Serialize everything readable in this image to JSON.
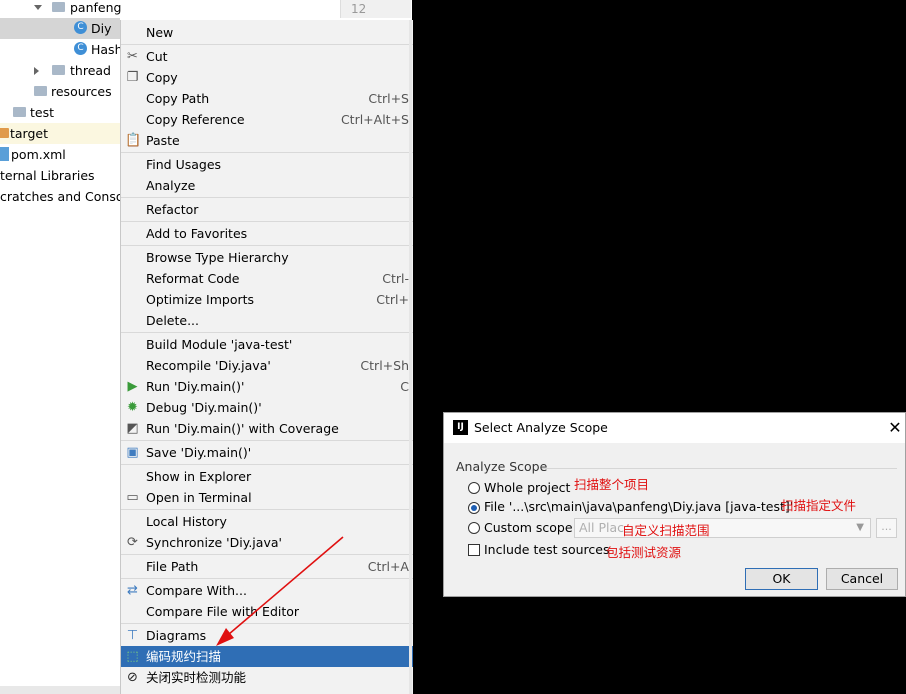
{
  "project_tree": {
    "gutter_line_number": "12",
    "items": [
      {
        "label": "panfeng",
        "kind": "folder",
        "state": "expanded"
      },
      {
        "label": "Diy",
        "kind": "class",
        "state": "selected"
      },
      {
        "label": "Hash",
        "kind": "class"
      },
      {
        "label": "thread",
        "kind": "folder",
        "state": "collapsed"
      },
      {
        "label": "resources",
        "kind": "folder"
      },
      {
        "label": "test",
        "kind": "folder"
      },
      {
        "label": "target",
        "kind": "folder-excluded",
        "state": "highlighted"
      },
      {
        "label": "pom.xml",
        "kind": "xml"
      },
      {
        "label": "ternal Libraries",
        "kind": "library"
      },
      {
        "label": "cratches and Console",
        "kind": "scratches"
      }
    ]
  },
  "context_menu": {
    "items": [
      {
        "label": "New"
      },
      {
        "label": "Cut",
        "icon": "scissors-icon"
      },
      {
        "label": "Copy",
        "icon": "copy-icon"
      },
      {
        "label": "Copy Path",
        "shortcut": "Ctrl+S"
      },
      {
        "label": "Copy Reference",
        "shortcut": "Ctrl+Alt+S"
      },
      {
        "label": "Paste",
        "icon": "paste-icon"
      },
      {
        "label": "Find Usages"
      },
      {
        "label": "Analyze"
      },
      {
        "label": "Refactor"
      },
      {
        "label": "Add to Favorites"
      },
      {
        "label": "Browse Type Hierarchy"
      },
      {
        "label": "Reformat Code",
        "shortcut": "Ctrl-"
      },
      {
        "label": "Optimize Imports",
        "shortcut": "Ctrl+"
      },
      {
        "label": "Delete..."
      },
      {
        "label": "Build Module 'java-test'"
      },
      {
        "label": "Recompile 'Diy.java'",
        "shortcut": "Ctrl+Sh"
      },
      {
        "label": "Run 'Diy.main()'",
        "icon": "run-icon",
        "shortcut": "C"
      },
      {
        "label": "Debug 'Diy.main()'",
        "icon": "debug-icon"
      },
      {
        "label": "Run 'Diy.main()' with Coverage",
        "icon": "coverage-icon"
      },
      {
        "label": "Save 'Diy.main()'",
        "icon": "save-icon"
      },
      {
        "label": "Show in Explorer"
      },
      {
        "label": "Open in Terminal",
        "icon": "terminal-icon"
      },
      {
        "label": "Local History"
      },
      {
        "label": "Synchronize 'Diy.java'",
        "icon": "sync-icon"
      },
      {
        "label": "File Path",
        "shortcut": "Ctrl+A"
      },
      {
        "label": "Compare With...",
        "icon": "compare-icon"
      },
      {
        "label": "Compare File with Editor"
      },
      {
        "label": "Diagrams",
        "icon": "diagram-icon"
      },
      {
        "label": "编码规约扫描",
        "icon": "scan-icon",
        "active": true
      },
      {
        "label": "关闭实时检测功能",
        "icon": "disable-icon"
      }
    ]
  },
  "dialog": {
    "title": "Select Analyze Scope",
    "group_label": "Analyze Scope",
    "options": {
      "whole_project": "Whole project",
      "file": "File '...\\src\\main\\java\\panfeng\\Diy.java [java-test]'",
      "custom_scope": "Custom scope",
      "include_tests": "Include test sources"
    },
    "custom_scope_value": "All Plac",
    "browse_label": "...",
    "selected_option": "file",
    "include_tests_checked": false,
    "ok_label": "OK",
    "cancel_label": "Cancel",
    "annotations": {
      "whole_project": "扫描整个项目",
      "file": "扫描指定文件",
      "custom_scope": "自定义扫描范围",
      "include_tests": "包括测试资源"
    },
    "annotation_color": "#e01010"
  }
}
